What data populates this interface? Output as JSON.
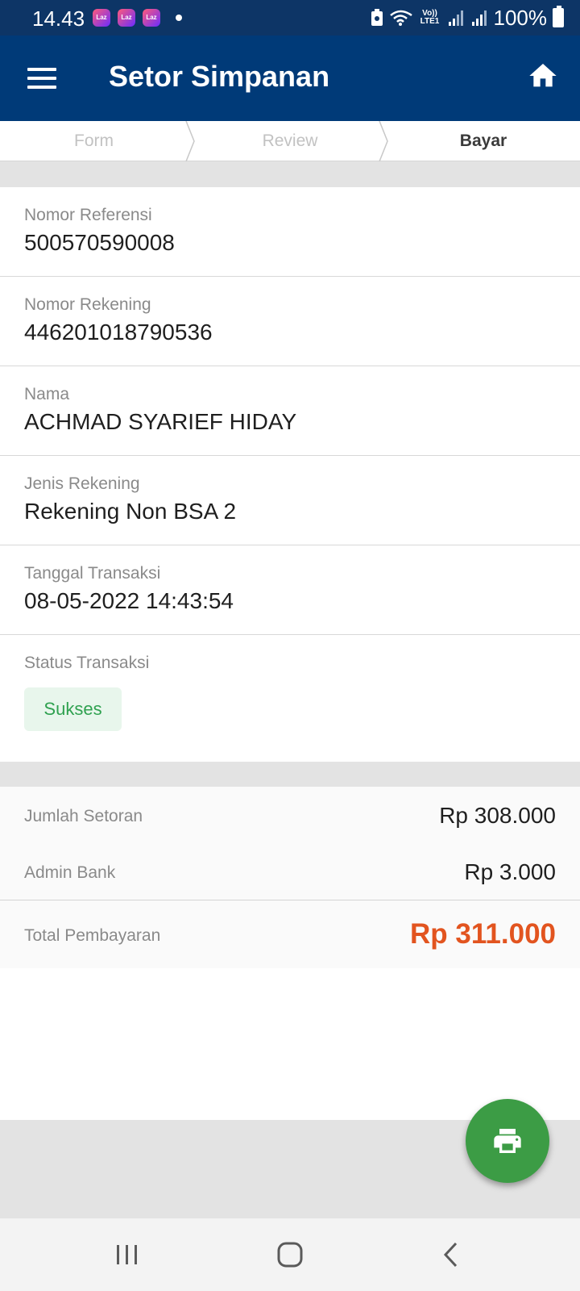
{
  "status_bar": {
    "time": "14.43",
    "notification_icons": [
      "Laz",
      "Laz",
      "Laz"
    ],
    "lte_label": "Vo)) LTE1",
    "battery_percent": "100%"
  },
  "app_bar": {
    "title": "Setor Simpanan",
    "menu_icon": "hamburger-menu-icon",
    "home_icon": "home-icon"
  },
  "steps": [
    {
      "label": "Form",
      "active": false
    },
    {
      "label": "Review",
      "active": false
    },
    {
      "label": "Bayar",
      "active": true
    }
  ],
  "details": [
    {
      "label": "Nomor Referensi",
      "value": "500570590008"
    },
    {
      "label": "Nomor Rekening",
      "value": "446201018790536"
    },
    {
      "label": "Nama",
      "value": "ACHMAD SYARIEF HIDAY"
    },
    {
      "label": "Jenis Rekening",
      "value": "Rekening Non BSA 2"
    },
    {
      "label": "Tanggal Transaksi",
      "value": "08-05-2022 14:43:54"
    }
  ],
  "status": {
    "label": "Status Transaksi",
    "badge": "Sukses",
    "badge_color": "#2fa150"
  },
  "summary": {
    "deposit_label": "Jumlah Setoran",
    "deposit_value": "Rp 308.000",
    "admin_label": "Admin Bank",
    "admin_value": "Rp 3.000",
    "total_label": "Total Pembayaran",
    "total_value": "Rp 311.000",
    "total_color": "#e2541f"
  },
  "fab": {
    "icon": "print-icon",
    "color": "#3c9c45"
  },
  "colors": {
    "app_bar": "#003a78",
    "status_bar": "#0d3566"
  }
}
